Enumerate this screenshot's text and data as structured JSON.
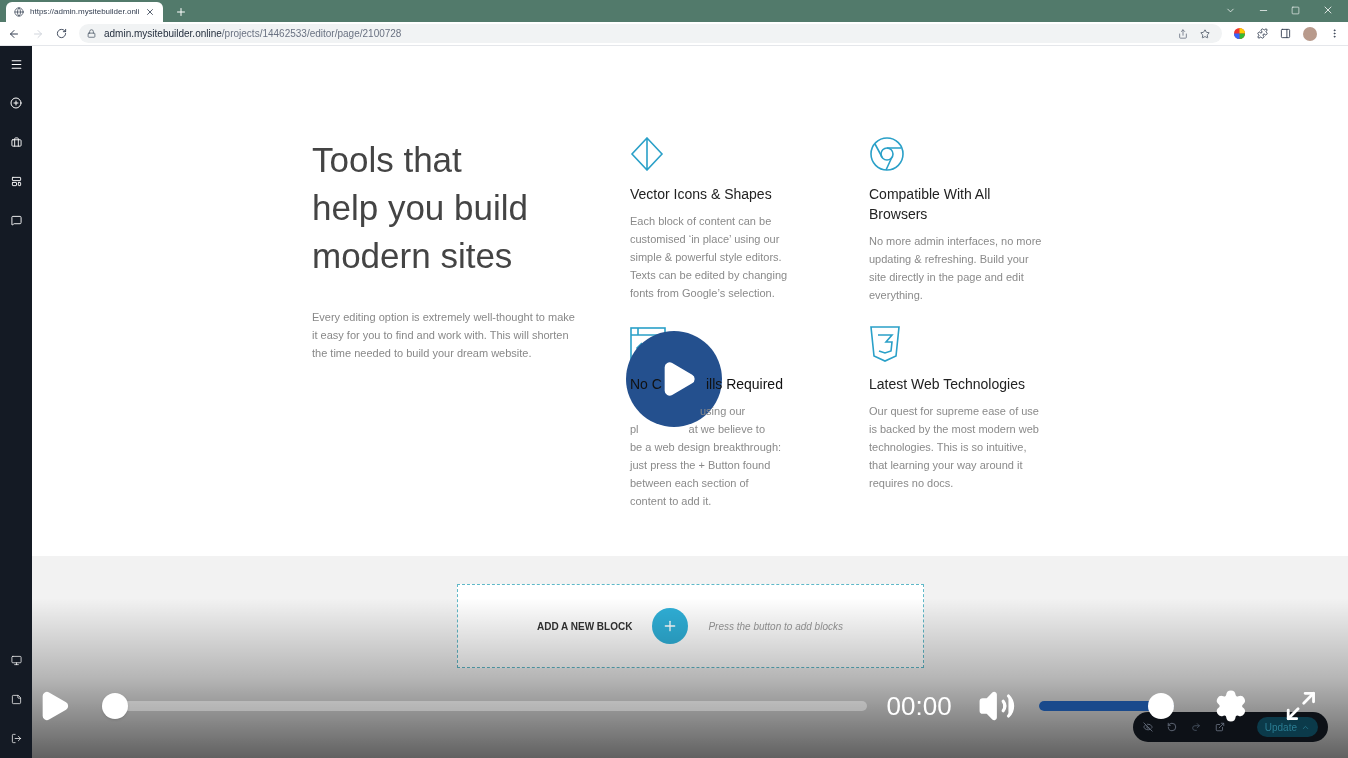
{
  "browser": {
    "tab_title": "https://admin.mysitebuilder.onli",
    "url_host": "admin.mysitebuilder.online",
    "url_path": "/projects/14462533/editor/page/2100728"
  },
  "hero": {
    "heading_lines": [
      "Tools that",
      "help you build",
      "modern sites"
    ],
    "text": "Every editing option is extremely well-thought to make it easy for you to find and work with. This will shorten the time needed to build your dream website."
  },
  "features": [
    {
      "kind": "diamond",
      "title": "Vector Icons & Shapes",
      "text": "Each block of content can be customised ‘in place’ using our simple & powerful style editors. Texts can be edited by changing fonts from Google’s selection."
    },
    {
      "kind": "browser",
      "title": "Compatible With All Browsers",
      "text": "No more admin interfaces, no more updating & refreshing. Build your site directly in the page and edit everything."
    },
    {
      "kind": "code",
      "title_parts": [
        "No C",
        "ills Required"
      ],
      "text_lines": [
        {
          "covered_start": true,
          "parts": [
            "using our"
          ]
        },
        {
          "parts": [
            "pl",
            "at we believe to"
          ]
        },
        {
          "parts": [
            "be a web design breakthrough:"
          ]
        },
        {
          "parts": [
            "just press the + Button found"
          ]
        },
        {
          "parts": [
            "between each section of"
          ]
        },
        {
          "parts": [
            "content to add it."
          ]
        }
      ]
    },
    {
      "kind": "css",
      "title": "Latest Web Technologies",
      "text": "Our quest for supreme ease of use is backed by the most modern web technologies. This is so intuitive, that learning your way around it requires no docs."
    }
  ],
  "add_block": {
    "label": "ADD A NEW BLOCK",
    "hint": "Press the button to add blocks"
  },
  "editor_toolbar": {
    "update_button": "Update"
  },
  "player": {
    "playing": false,
    "time": "00:00",
    "progress": {
      "level": 0
    },
    "volume": {
      "level": 1
    }
  }
}
